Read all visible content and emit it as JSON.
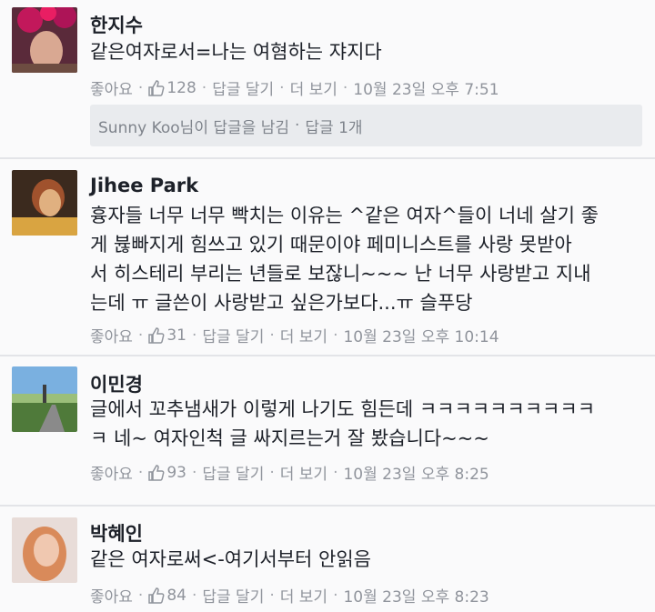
{
  "comments": [
    {
      "name": "한지수",
      "lines": [
        "같은여자로서=나는 여혐하는 쟈지다"
      ],
      "meta": {
        "like": "좋아요",
        "count": "128",
        "reply": "답글 달기",
        "more": "더 보기",
        "time": "10월 23일 오후 7:51"
      },
      "replies": {
        "text": "Sunny Koo님이 답글을 남김",
        "count": "답글 1개"
      }
    },
    {
      "name": "Jihee Park",
      "lines": [
        "흉자들 너무 너무 빡치는 이유는 ^같은 여자^들이 너네 살기 좋",
        "게 뷶빠지게 힘쓰고 있기 때문이야 페미니스트를 사랑 못받아",
        "서 히스테리 부리는 년들로 보잖니~~~ 난 너무 사랑받고 지내",
        "는데 ㅠ 글쓴이 사랑받고 싶은가보다...ㅠ 슬푸당"
      ],
      "meta": {
        "like": "좋아요",
        "count": "31",
        "reply": "답글 달기",
        "more": "더 보기",
        "time": "10월 23일 오후 10:14"
      }
    },
    {
      "name": "이민경",
      "lines": [
        "글에서 꼬추냄새가 이렇게 나기도 힘든데 ㅋㅋㅋㅋㅋㅋㅋㅋㅋㅋ",
        "ㅋ 네~ 여자인척 글 싸지르는거 잘 봤습니다~~~"
      ],
      "meta": {
        "like": "좋아요",
        "count": "93",
        "reply": "답글 달기",
        "more": "더 보기",
        "time": "10월 23일 오후 8:25"
      }
    },
    {
      "name": "박혜인",
      "lines": [
        "같은 여자로써<-여기서부터 안읽음"
      ],
      "meta": {
        "like": "좋아요",
        "count": "84",
        "reply": "답글 달기",
        "more": "더 보기",
        "time": "10월 23일 오후 8:23"
      }
    }
  ],
  "colors": {
    "name": "#1d2129",
    "meta": "#90949c",
    "like_icon": "#90949c",
    "reply_box": "#e9ebee"
  },
  "icons": {
    "like": "thumbs-up-icon"
  }
}
